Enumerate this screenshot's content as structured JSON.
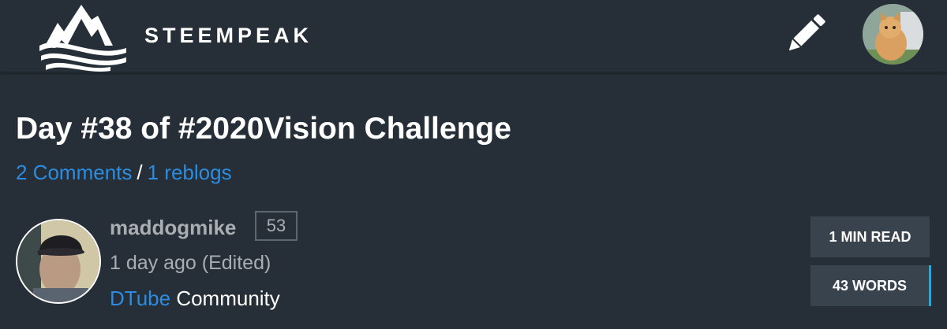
{
  "header": {
    "brand_name": "STEEMPEAK",
    "logo_icon": "mountain-waves-logo",
    "edit_icon": "pencil-icon",
    "user_avatar_icon": "kitten-avatar"
  },
  "post": {
    "title": "Day #38 of #2020Vision Challenge",
    "comments_link": "2 Comments",
    "separator": "/",
    "reblogs_link": "1 reblogs",
    "author": {
      "name": "maddogmike",
      "reputation": "53",
      "avatar_icon": "author-avatar",
      "timestamp": "1 day ago (Edited)"
    },
    "community": {
      "name": "DTube",
      "label": "Community"
    },
    "read_time": "1 MIN READ",
    "word_count": "43 WORDS"
  },
  "colors": {
    "background": "#262f38",
    "link": "#2c8ce0",
    "muted_text": "#a9aeb3",
    "info_box_bg": "#39434d",
    "accent": "#2aa6d8"
  }
}
